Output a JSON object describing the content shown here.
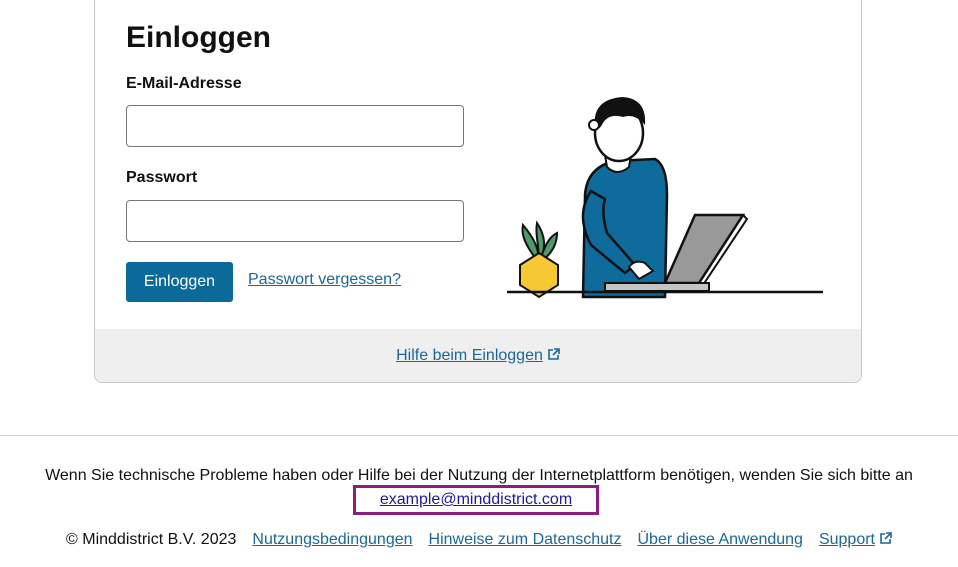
{
  "login": {
    "title": "Einloggen",
    "email_label": "E-Mail-Adresse",
    "email_value": "",
    "password_label": "Passwort",
    "password_value": "",
    "submit_label": "Einloggen",
    "forgot_label": "Passwort vergessen?"
  },
  "card_footer": {
    "help_link_label": "Hilfe beim Einloggen",
    "icon": "external-link-icon"
  },
  "support": {
    "text": "Wenn Sie technische Probleme haben oder Hilfe bei der Nutzung der Internetplattform benötigen, wenden Sie sich bitte an",
    "email": "example@minddistrict.com"
  },
  "footer": {
    "copyright": "© Minddistrict B.V. 2023",
    "links": [
      "Nutzungsbedingungen",
      "Hinweise zum Datenschutz",
      "Über diese Anwendung",
      "Support"
    ]
  },
  "colors": {
    "primary": "#0b6a9a",
    "link": "#1a6896",
    "highlight": "#8b1e7e",
    "footer_bg": "#efefef"
  }
}
